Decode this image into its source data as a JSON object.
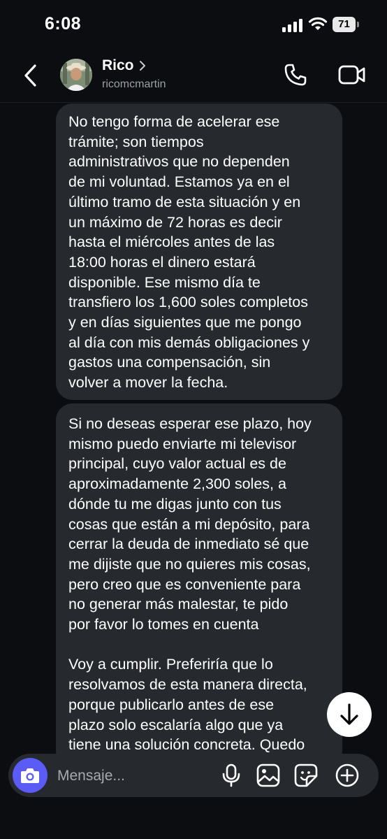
{
  "status_bar": {
    "time": "6:08",
    "battery": "71"
  },
  "header": {
    "name": "Rico",
    "username": "ricomcmartin"
  },
  "messages": [
    {
      "text": "No tengo forma de acelerar ese\ntrámite; son tiempos\nadministrativos que no dependen\nde mi voluntad. Estamos ya en el\núltimo tramo de esta situación y en\nun máximo de 72 horas es decir\nhasta el miércoles antes de las\n18:00 horas el dinero estará\ndisponible. Ese mismo día te\ntransfiero los 1,600 soles completos\ny en días siguientes que me pongo\nal día con mis demás obligaciones y\ngastos una compensación, sin\nvolver a mover la fecha."
    },
    {
      "text": "Si no deseas esperar ese plazo, hoy\nmismo puedo enviarte mi televisor\nprincipal, cuyo valor actual es de\naproximadamente 2,300 soles, a\ndónde tu me digas junto con tus\ncosas que están a mi depósito, para\ncerrar la deuda de inmediato sé que\nme dijiste que no quieres mis cosas,\npero creo que es conveniente para\nno generar más malestar, te pido\npor favor lo tomes en cuenta\n\nVoy a cumplir. Preferiría que lo\nresolvamos de esta manera directa,\nporque publicarlo antes de ese\nplazo solo escalaría algo que ya\ntiene una solución concreta. Quedo"
    }
  ],
  "composer": {
    "placeholder": "Mensaje..."
  },
  "icons": {
    "back": "chevron-left-icon",
    "call": "phone-icon",
    "video": "video-camera-icon",
    "camera": "camera-icon",
    "mic": "microphone-icon",
    "gallery": "image-icon",
    "sticker": "sticker-icon",
    "add": "plus-circle-icon",
    "scroll": "arrow-down-icon"
  },
  "colors": {
    "background": "#0b0d10",
    "bubble": "#262a2e",
    "camera_button": "#5b5bf5"
  }
}
